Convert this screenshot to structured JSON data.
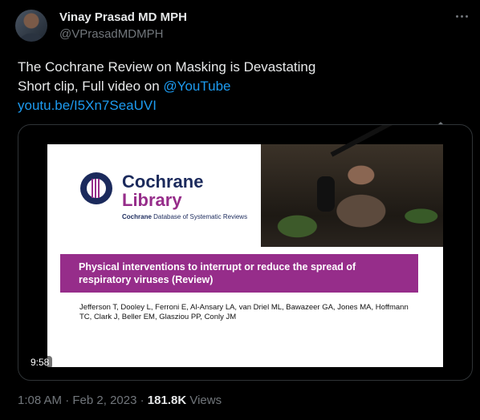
{
  "author": {
    "name": "Vinay Prasad MD MPH",
    "handle": "@VPrasadMDMPH"
  },
  "tweet": {
    "line1": "The Cochrane Review on Masking is Devastating",
    "line2_text": "Short clip, Full video on ",
    "line2_link": "@YouTube",
    "url": "youtu.be/I5Xn7SeaUVI"
  },
  "video": {
    "brand_line1": "Cochrane",
    "brand_line2": "Library",
    "brand_sub_bold": "Cochrane",
    "brand_sub_rest": " Database of Systematic Reviews",
    "banner_title": "Physical interventions to interrupt or reduce the spread of respiratory viruses (Review)",
    "authors": "Jefferson T, Dooley L, Ferroni E, Al-Ansary LA, van Driel ML, Bawazeer GA, Jones MA, Hoffmann TC, Clark J, Beller EM, Glasziou PP, Conly JM",
    "duration": "9:58"
  },
  "meta": {
    "time": "1:08 AM",
    "sep1": " · ",
    "date": "Feb 2, 2023",
    "sep2": " · ",
    "views_count": "181.8K",
    "views_label": " Views"
  },
  "colors": {
    "link": "#1d9bf0",
    "cochrane_navy": "#1b2a5c",
    "cochrane_purple": "#962d8a"
  }
}
